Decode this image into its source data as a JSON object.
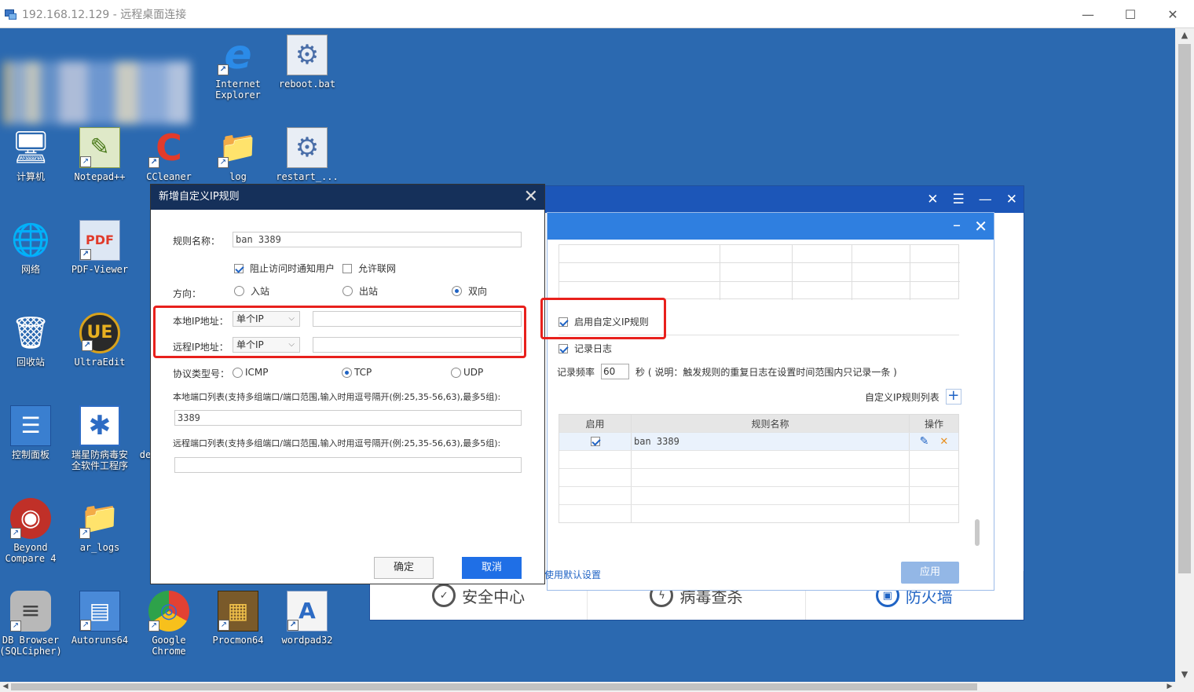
{
  "rdp": {
    "title": "192.168.12.129 - 远程桌面连接",
    "minimize": "—",
    "maximize": "☐",
    "close": "✕"
  },
  "desktop": {
    "icons": [
      {
        "label": "Internet\nExplorer",
        "glyph": "e"
      },
      {
        "label": "reboot.bat",
        "glyph": "⚙"
      },
      {
        "label": "计算机",
        "glyph": "🖥"
      },
      {
        "label": "Notepad++",
        "glyph": "✎"
      },
      {
        "label": "CCleaner",
        "glyph": "C"
      },
      {
        "label": "log",
        "glyph": "📁"
      },
      {
        "label": "restart_...",
        "glyph": "⚙"
      },
      {
        "label": "网络",
        "glyph": "🌐"
      },
      {
        "label": "PDF-Viewer",
        "glyph": "PDF"
      },
      {
        "label": "回收站",
        "glyph": "🗑"
      },
      {
        "label": "UltraEdit",
        "glyph": "UE"
      },
      {
        "label": "控制面板",
        "glyph": "☰"
      },
      {
        "label": "瑞星防病毒安\n全软件工程序",
        "glyph": "✱"
      },
      {
        "label": "Beyond\nCompare 4",
        "glyph": "◉"
      },
      {
        "label": "ar_logs",
        "glyph": "📁"
      },
      {
        "label": "DB Browser\n(SQLCipher)",
        "glyph": "≡"
      },
      {
        "label": "Autoruns64",
        "glyph": "▤"
      },
      {
        "label": "Google\nChrome",
        "glyph": "◎"
      },
      {
        "label": "Procmon64",
        "glyph": "▦"
      },
      {
        "label": "wordpad32",
        "glyph": "A"
      }
    ],
    "partial_label": "de"
  },
  "security_app": {
    "bottom_tabs": [
      {
        "label": "安全中心",
        "glyph": "✓"
      },
      {
        "label": "病毒查杀",
        "glyph": "ϟ"
      },
      {
        "label": "防火墙",
        "glyph": "▣"
      }
    ]
  },
  "settings": {
    "enable_custom_ip": "启用自定义IP规则",
    "log_label": "记录日志",
    "freq_label": "记录频率",
    "freq_value": "60",
    "freq_note": "秒 ( 说明：触发规则的重复日志在设置时间范围内只记录一条 )",
    "list_title": "自定义IP规则列表",
    "add": "+",
    "columns": {
      "enable": "启用",
      "name": "规则名称",
      "ops": "操作"
    },
    "rules": [
      {
        "name": "ban 3389"
      }
    ],
    "apply": "应用",
    "restore_default": "使用默认设置"
  },
  "add_rule": {
    "title": "新增自定义IP规则",
    "rule_name_label": "规则名称：",
    "rule_name_value": "ban 3389",
    "block_notify": "阻止访问时通知用户",
    "allow_net": "允许联网",
    "direction_label": "方向：",
    "direction_options": [
      "入站",
      "出站",
      "双向"
    ],
    "local_ip_label": "本地IP地址：",
    "remote_ip_label": "远程IP地址：",
    "ip_mode": "单个IP",
    "protocol_label": "协议类型号：",
    "protocols": [
      "ICMP",
      "TCP",
      "UDP"
    ],
    "local_ports_label": "本地端口列表(支持多组端口/端口范围,输入时用逗号隔开(例:25,35-56,63),最多5组):",
    "local_ports_value": "3389",
    "remote_ports_label": "远程端口列表(支持多组端口/端口范围,输入时用逗号隔开(例:25,35-56,63),最多5组):",
    "ok": "确定",
    "cancel": "取消"
  }
}
